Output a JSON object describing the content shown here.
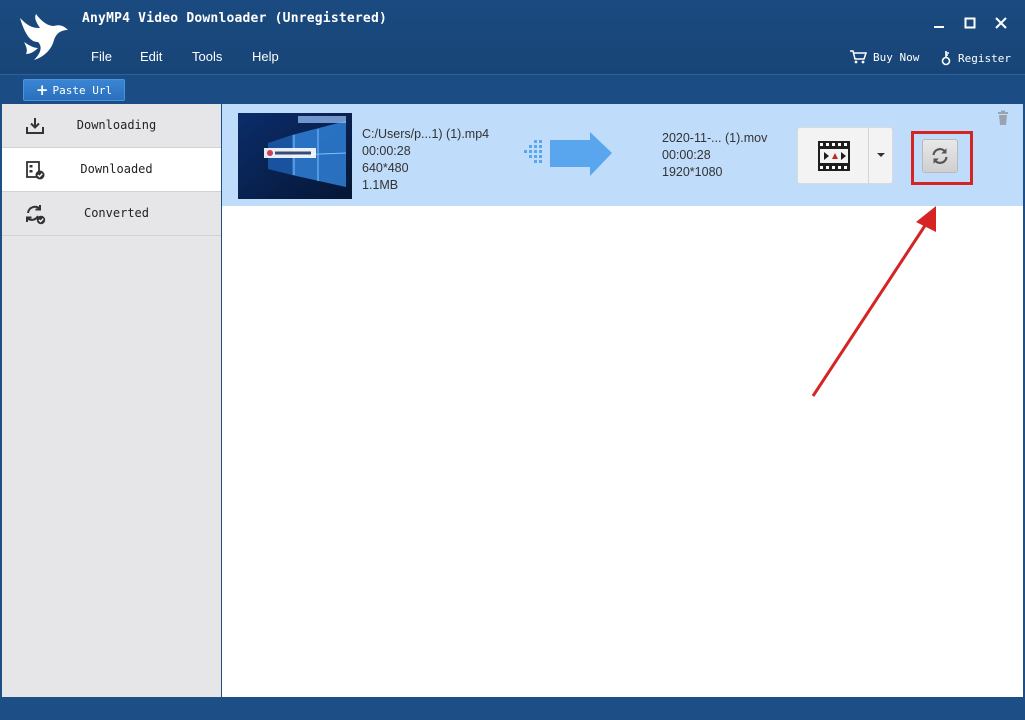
{
  "app": {
    "title": "AnyMP4 Video Downloader (Unregistered)",
    "logo_icon": "bird-logo-icon"
  },
  "window_controls": {
    "minimize": "─",
    "maximize": "□",
    "close": "✕"
  },
  "menu": [
    {
      "label": "File"
    },
    {
      "label": "Edit"
    },
    {
      "label": "Tools"
    },
    {
      "label": "Help"
    }
  ],
  "top_actions": {
    "buy_now": "Buy Now",
    "register": "Register"
  },
  "toolbar": {
    "paste_url": "Paste Url"
  },
  "sidebar": {
    "items": [
      {
        "label": "Downloading",
        "icon": "download-icon",
        "active": false
      },
      {
        "label": "Downloaded",
        "icon": "film-check-icon",
        "active": true
      },
      {
        "label": "Converted",
        "icon": "refresh-check-icon",
        "active": false
      }
    ]
  },
  "row": {
    "source": {
      "path": "C:/Users/p...1) (1).mp4",
      "duration": "00:00:28",
      "resolution": "640*480",
      "size": "1.1MB"
    },
    "output": {
      "name": "2020-11-... (1).mov",
      "duration": "00:00:28",
      "resolution": "1920*1080"
    }
  },
  "colors": {
    "title_bar": "#1a4a80",
    "row_selected": "#bfdcfa",
    "sidebar_bg": "#e6e6e8",
    "highlight": "#d42424",
    "arrow": "#5aa6ee"
  }
}
